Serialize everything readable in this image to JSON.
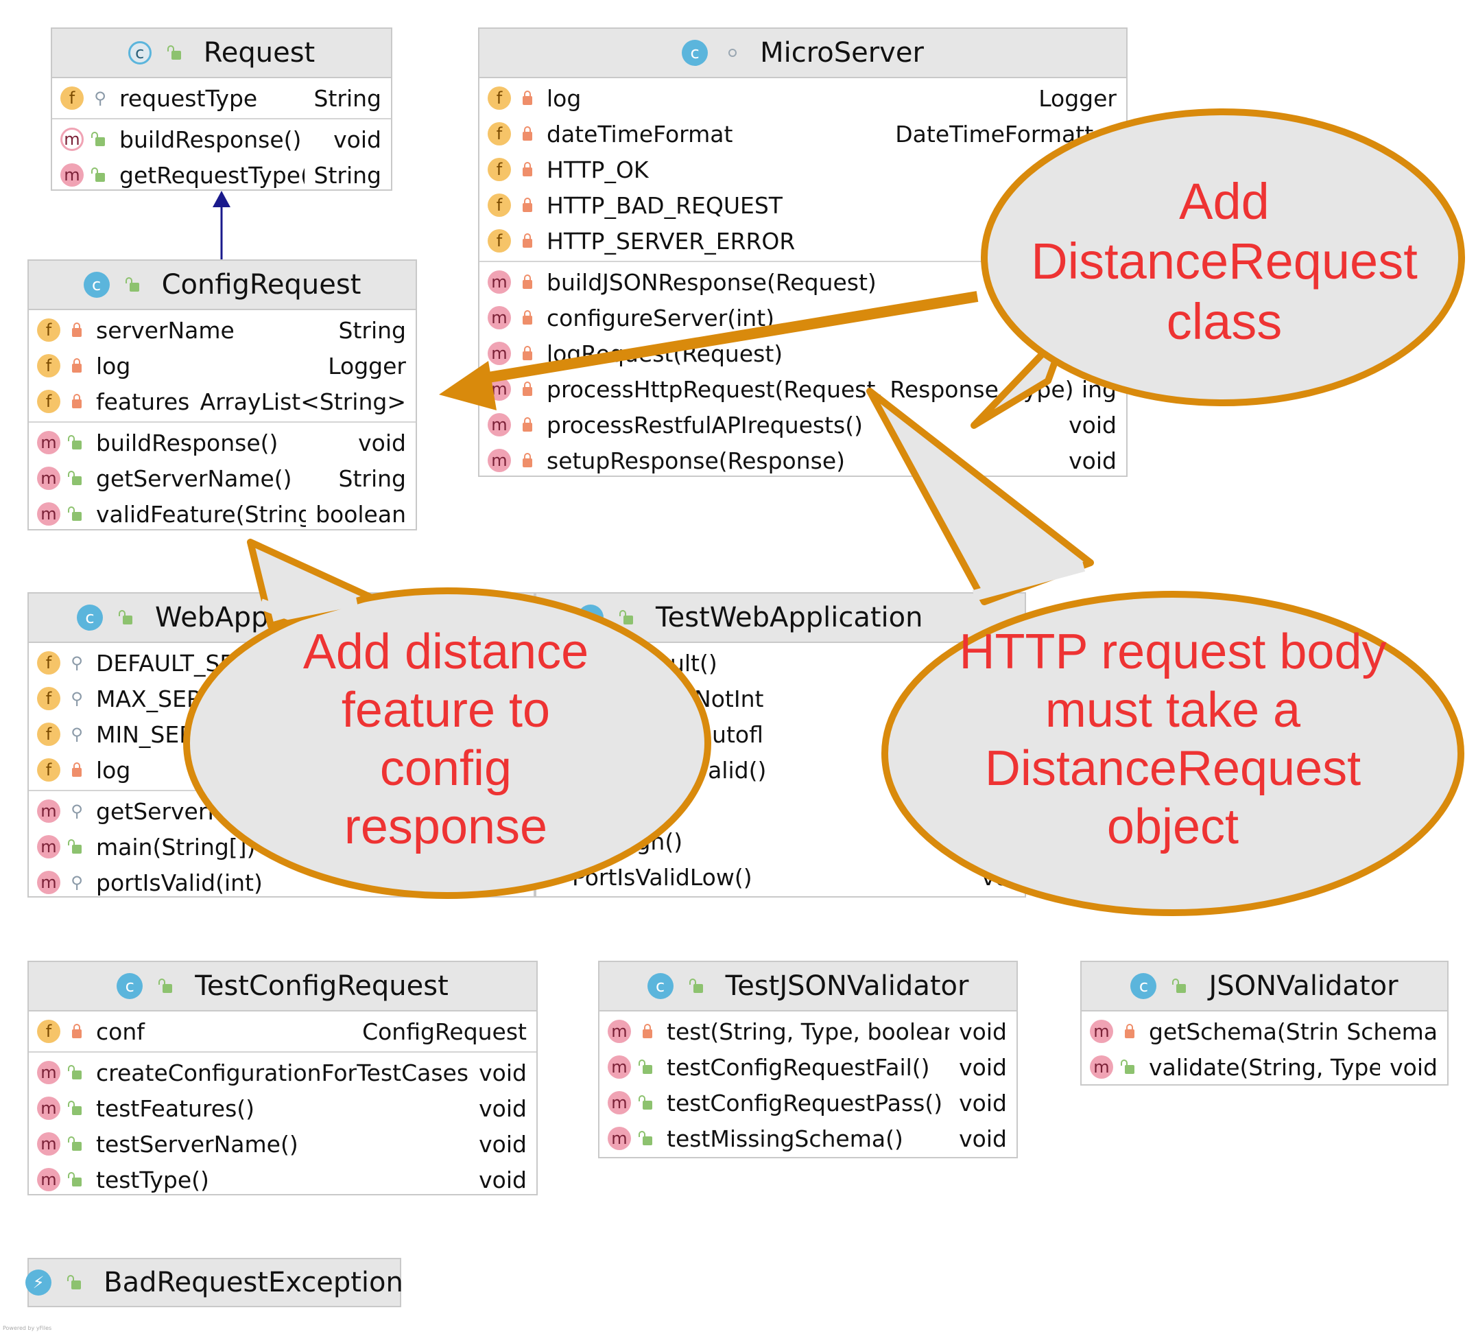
{
  "classes": {
    "request": {
      "name": "Request",
      "fields": [
        {
          "name": "requestType",
          "type": "String"
        }
      ],
      "methods": [
        {
          "name": "buildResponse()",
          "type": "void"
        },
        {
          "name": "getRequestType()",
          "type": "String"
        }
      ]
    },
    "microserver": {
      "name": "MicroServer",
      "fields": [
        {
          "name": "log",
          "type": "Logger"
        },
        {
          "name": "dateTimeFormat",
          "type": "DateTimeFormatter"
        },
        {
          "name": "HTTP_OK",
          "type": ""
        },
        {
          "name": "HTTP_BAD_REQUEST",
          "type": ""
        },
        {
          "name": "HTTP_SERVER_ERROR",
          "type": ""
        }
      ],
      "methods": [
        {
          "name": "buildJSONResponse(Request)",
          "type": ""
        },
        {
          "name": "configureServer(int)",
          "type": ""
        },
        {
          "name": "logRequest(Request)",
          "type": ""
        },
        {
          "name": "processHttpRequest(Request, Response, Type)",
          "type": "ing"
        },
        {
          "name": "processRestfulAPIrequests()",
          "type": "void"
        },
        {
          "name": "setupResponse(Response)",
          "type": "void"
        }
      ]
    },
    "configrequest": {
      "name": "ConfigRequest",
      "fields": [
        {
          "name": "serverName",
          "type": "String"
        },
        {
          "name": "log",
          "type": "Logger"
        },
        {
          "name": "features",
          "type": "ArrayList<String>"
        }
      ],
      "methods": [
        {
          "name": "buildResponse()",
          "type": "void"
        },
        {
          "name": "getServerName()",
          "type": "String"
        },
        {
          "name": "validFeature(String)",
          "type": "boolean"
        }
      ]
    },
    "webapplication": {
      "name": "WebAppli",
      "fields": [
        {
          "name": "DEFAULT_SE",
          "type": ""
        },
        {
          "name": "MAX_SER",
          "type": ""
        },
        {
          "name": "MIN_SER",
          "type": ""
        },
        {
          "name": "log",
          "type": ""
        }
      ],
      "methods": [
        {
          "name": "getServerP",
          "type": ""
        },
        {
          "name": "main(String[])",
          "type": ""
        },
        {
          "name": "portIsValid(int)",
          "type": "bo"
        }
      ]
    },
    "testwebapplication": {
      "name": "TestWebApplication",
      "methods": [
        {
          "name": "PortDefault()",
          "type": ""
        },
        {
          "name": "rtSpecifiedNotInt",
          "type": ""
        },
        {
          "name": "rtSpecifiedOutofl",
          "type": ""
        },
        {
          "name": "rtSpecifiedValid()",
          "type": ""
        },
        {
          "name": "()",
          "type": ""
        },
        {
          "name": "alidHigh()",
          "type": ""
        },
        {
          "name": "PortIsValidLow()",
          "type": "voi"
        }
      ]
    },
    "testconfigrequest": {
      "name": "TestConfigRequest",
      "fields": [
        {
          "name": "conf",
          "type": "ConfigRequest"
        }
      ],
      "methods": [
        {
          "name": "createConfigurationForTestCases()",
          "type": "void"
        },
        {
          "name": "testFeatures()",
          "type": "void"
        },
        {
          "name": "testServerName()",
          "type": "void"
        },
        {
          "name": "testType()",
          "type": "void"
        }
      ]
    },
    "testjsonvalidator": {
      "name": "TestJSONValidator",
      "methods": [
        {
          "name": "test(String, Type, boolean)",
          "type": "void"
        },
        {
          "name": "testConfigRequestFail()",
          "type": "void"
        },
        {
          "name": "testConfigRequestPass()",
          "type": "void"
        },
        {
          "name": "testMissingSchema()",
          "type": "void"
        }
      ]
    },
    "jsonvalidator": {
      "name": "JSONValidator",
      "methods": [
        {
          "name": "getSchema(String)",
          "type": "Schema"
        },
        {
          "name": "validate(String, Type)",
          "type": "void"
        }
      ]
    },
    "badrequestexception": {
      "name": "BadRequestException"
    }
  },
  "badges": {
    "field": "f",
    "method": "m",
    "class": "c"
  },
  "bubbles": {
    "distance_request_class": [
      "Add",
      "DistanceRequest",
      "class"
    ],
    "distance_feature": [
      "Add distance",
      "feature to",
      "config",
      "response"
    ],
    "http_body": [
      "HTTP request body",
      "must take a",
      "DistanceRequest",
      "object"
    ]
  },
  "colors": {
    "bubble_fill": "#e6e6e6",
    "bubble_stroke": "#d98a0c",
    "bubble_text": "#ee3333",
    "inheritance_arrow": "#1a1a8c"
  },
  "footer": "Powered by yFiles"
}
